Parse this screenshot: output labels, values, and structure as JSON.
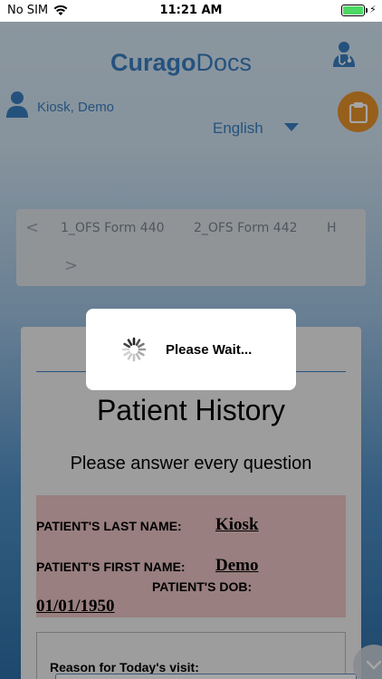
{
  "status_bar": {
    "carrier": "No SIM",
    "time": "11:21 AM",
    "battery_color": "#4cd964"
  },
  "header": {
    "logo_part1": "Curago",
    "logo_part2": "Docs",
    "brand_color": "#3a7fc1",
    "user_name": "Kiosk, Demo",
    "language": "English",
    "clipboard_color": "#e6922a"
  },
  "tabs": {
    "items": [
      "1_OFS Form 440",
      "2_OFS Form 442",
      "H"
    ],
    "prev_glyph": "<",
    "next_glyph": ">"
  },
  "form": {
    "title": "Patient History",
    "subtitle": "Please answer every question",
    "last_name_label": "PATIENT'S LAST NAME:",
    "last_name_value": "Kiosk",
    "first_name_label": "PATIENT'S FIRST NAME:",
    "first_name_value": "Demo",
    "dob_label": "PATIENT'S DOB:",
    "dob_value": "01/01/1950",
    "reason_label": "Reason for Today's visit:"
  },
  "dialog": {
    "message": "Please Wait..."
  }
}
